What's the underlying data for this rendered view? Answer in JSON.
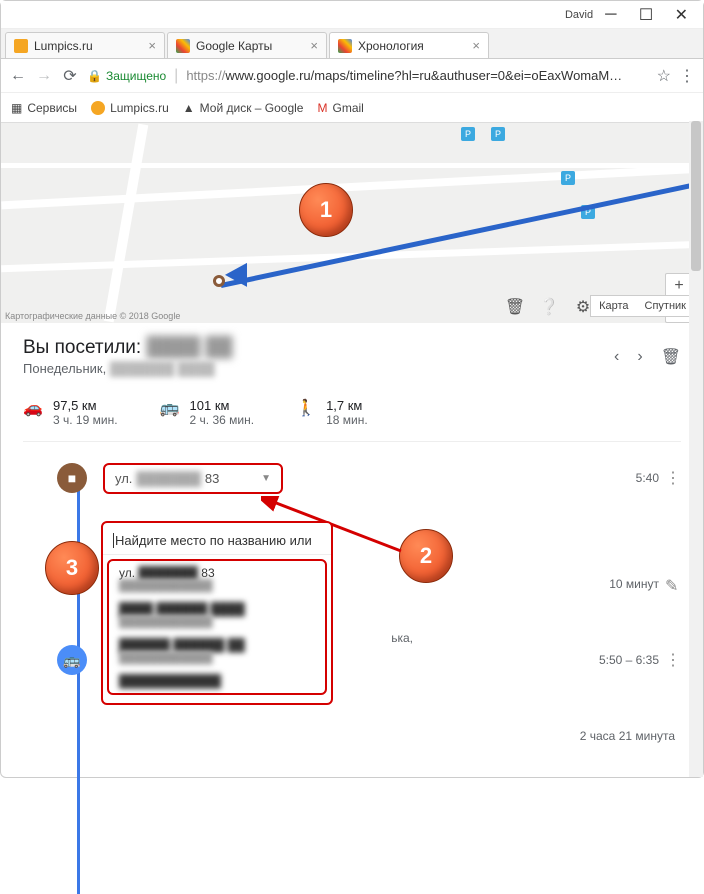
{
  "window": {
    "user": "David"
  },
  "tabs": [
    {
      "label": "Lumpics.ru"
    },
    {
      "label": "Google Карты"
    },
    {
      "label": "Хронология"
    }
  ],
  "omnibox": {
    "secure": "Защищено",
    "protocol": "https://",
    "url": "www.google.ru/maps/timeline?hl=ru&authuser=0&ei=oEaxWomaM…"
  },
  "bookmarks": {
    "apps": "Сервисы",
    "b1": "Lumpics.ru",
    "b2": "Мой диск – Google",
    "b3": "Gmail"
  },
  "map": {
    "attrib": "Картографические данные © 2018 Google",
    "type_map": "Карта",
    "type_sat": "Спутник"
  },
  "header": {
    "title_prefix": "Вы посетили:",
    "title_blur": "████ ██",
    "subtitle": "Понедельник,",
    "subtitle_blur": "███████ ████"
  },
  "stats": {
    "car_v": "97,5 км",
    "car_s": "3 ч. 19 мин.",
    "bus_v": "101 км",
    "bus_s": "2 ч. 36 мин.",
    "walk_v": "1,7 км",
    "walk_s": "18 мин."
  },
  "timeline": {
    "row1_prefix": "ул.",
    "row1_blur": "███████",
    "row1_suffix": "83",
    "row1_time": "5:40",
    "row2_dur": "10 минут",
    "row3_time": "5:50 – 6:35",
    "row4_dur": "2 часа 21 минута"
  },
  "dropdown": {
    "search_placeholder": "Найдите место по названию или",
    "item1_l1_pre": "ул.",
    "item1_l1_blur": "███████",
    "item1_l1_suf": "83",
    "side_text": "ька,"
  },
  "annotations": {
    "n1": "1",
    "n2": "2",
    "n3": "3"
  }
}
